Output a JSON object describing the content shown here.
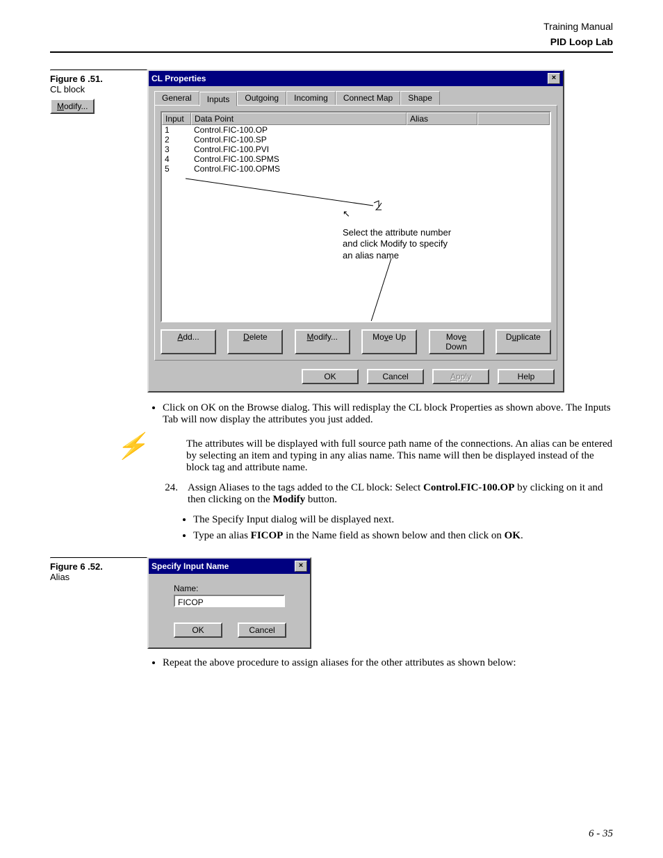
{
  "header": {
    "line1": "Training Manual",
    "line2": "PID Loop Lab"
  },
  "fig51": {
    "num": "Figure 6 .51.",
    "caption": "CL block",
    "modify_btn": "odify...",
    "modify_accel": "M"
  },
  "cl_dialog": {
    "title": "CL Properties",
    "tabs": [
      "General",
      "Inputs",
      "Outgoing",
      "Incoming",
      "Connect Map",
      "Shape"
    ],
    "active_tab": 1,
    "cols": {
      "c1": "Input",
      "c2": "Data Point",
      "c3": "Alias"
    },
    "rows": [
      {
        "n": "1",
        "dp": "Control.FIC-100.OP"
      },
      {
        "n": "2",
        "dp": "Control.FIC-100.SP"
      },
      {
        "n": "3",
        "dp": "Control.FIC-100.PVI"
      },
      {
        "n": "4",
        "dp": "Control.FIC-100.SPMS"
      },
      {
        "n": "5",
        "dp": "Control.FIC-100.OPMS"
      }
    ],
    "annot": "Select the attribute number\nand click Modify to specify\nan alias name",
    "buttons": {
      "add": "Add...",
      "add_u": "A",
      "delete": "Delete",
      "delete_u": "D",
      "modify": "Modify...",
      "modify_u": "M",
      "moveup": "Move Up",
      "moveup_u": "v",
      "movedown": "Move Down",
      "movedown_u": "e",
      "dup": "Duplicate",
      "dup_u": "u"
    },
    "footer": {
      "ok": "OK",
      "cancel": "Cancel",
      "apply": "Apply",
      "help": "Help"
    }
  },
  "body": {
    "bullet1": "Click on OK on the Browse dialog. This will redisplay the CL block Properties as shown above. The Inputs Tab will now display the attributes you just added.",
    "note": "The attributes will be displayed with full source path name of the connections. An alias can be entered by selecting an item and typing in any alias name. This name will then be displayed instead of the block tag and attribute name.",
    "step24_num": "24.",
    "step24_a": "Assign Aliases to the tags added to the CL block: Select ",
    "step24_bold1": "Control.FIC-100.OP",
    "step24_b": " by clicking on it and then clicking on the ",
    "step24_bold2": "Modify",
    "step24_c": " button.",
    "bullet2": "The Specify Input dialog will be displayed next.",
    "bullet3_a": "Type an alias ",
    "bullet3_bold": "FICOP",
    "bullet3_b": " in the Name field as shown below and then click on ",
    "bullet3_bold2": "OK",
    "bullet3_c": ".",
    "bullet4": "Repeat the above procedure to assign aliases for the other attributes as shown below:"
  },
  "fig52": {
    "num": "Figure 6 .52.",
    "caption": "Alias"
  },
  "input_dialog": {
    "title": "Specify Input Name",
    "name_label": "Name:",
    "name_value": "FICOP",
    "ok": "OK",
    "cancel": "Cancel"
  },
  "footer": "6 - 35"
}
